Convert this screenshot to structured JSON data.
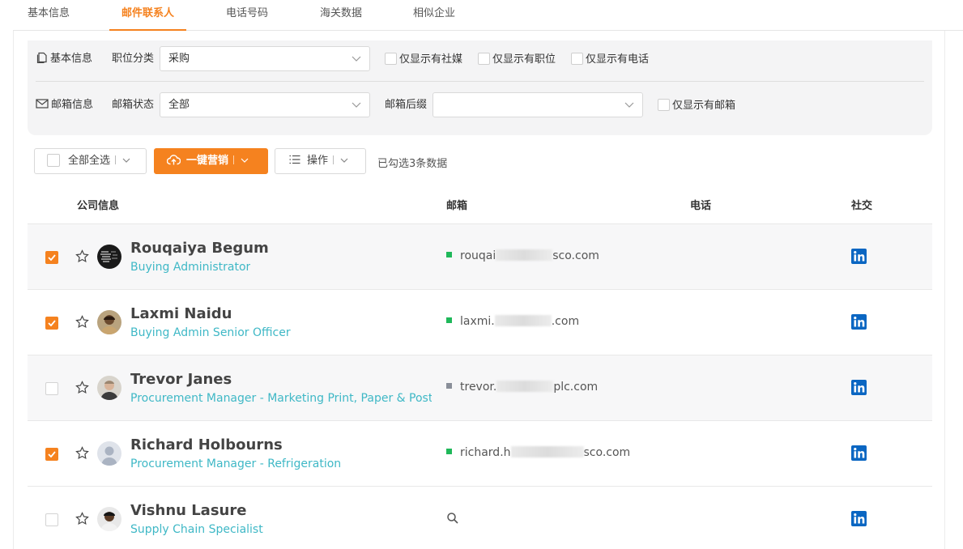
{
  "tabs": [
    {
      "label": "基本信息",
      "active": false
    },
    {
      "label": "邮件联系人",
      "active": true
    },
    {
      "label": "电话号码",
      "active": false
    },
    {
      "label": "海关数据",
      "active": false
    },
    {
      "label": "相似企业",
      "active": false
    }
  ],
  "filters": {
    "basic_label": "基本信息",
    "position_label": "职位分类",
    "position_value": "采购",
    "only_social": "仅显示有社媒",
    "only_position": "仅显示有职位",
    "only_phone": "仅显示有电话",
    "email_label": "邮箱信息",
    "email_status_label": "邮箱状态",
    "email_status_value": "全部",
    "email_suffix_label": "邮箱后缀",
    "email_suffix_value": "",
    "only_email": "仅显示有邮箱"
  },
  "toolbar": {
    "select_all_label": "全部全选",
    "marketing_label": "一键营销",
    "operate_label": "操作",
    "selected_info": "已勾选3条数据"
  },
  "table": {
    "headers": [
      "公司信息",
      "邮箱",
      "电话",
      "社交"
    ],
    "rows": [
      {
        "name": "Rouqaiya Begum",
        "title": "Buying Administrator",
        "email_start": "rouqai",
        "email_end": "sco.com",
        "email_status": "valid",
        "checked": true,
        "social": "linkedin-icon"
      },
      {
        "name": "Laxmi Naidu",
        "title": "Buying Admin Senior Officer",
        "email_start": "laxmi.",
        "email_end": ".com",
        "email_status": "valid",
        "checked": true,
        "social": "linkedin-icon"
      },
      {
        "name": "Trevor Janes",
        "title": "Procurement Manager - Marketing Print, Paper & Post - …",
        "email_start": "trevor.",
        "email_end": "plc.com",
        "email_status": "unknown",
        "checked": false,
        "social": "linkedin-icon"
      },
      {
        "name": "Richard Holbourns",
        "title": "Procurement Manager - Refrigeration",
        "email_start": "richard.h",
        "email_end": "sco.com",
        "email_status": "valid",
        "checked": true,
        "social": "linkedin-icon"
      },
      {
        "name": "Vishnu Lasure",
        "title": "Supply Chain Specialist",
        "email_start": "",
        "email_end": "",
        "email_status": "none",
        "checked": false,
        "social": "linkedin-icon"
      }
    ]
  },
  "colors": {
    "accent": "#f5821f",
    "title_link": "#3fb8c6",
    "valid_dot": "#1fb85a",
    "unknown_dot": "#8a8f99",
    "linkedin": "#0a66c2"
  }
}
